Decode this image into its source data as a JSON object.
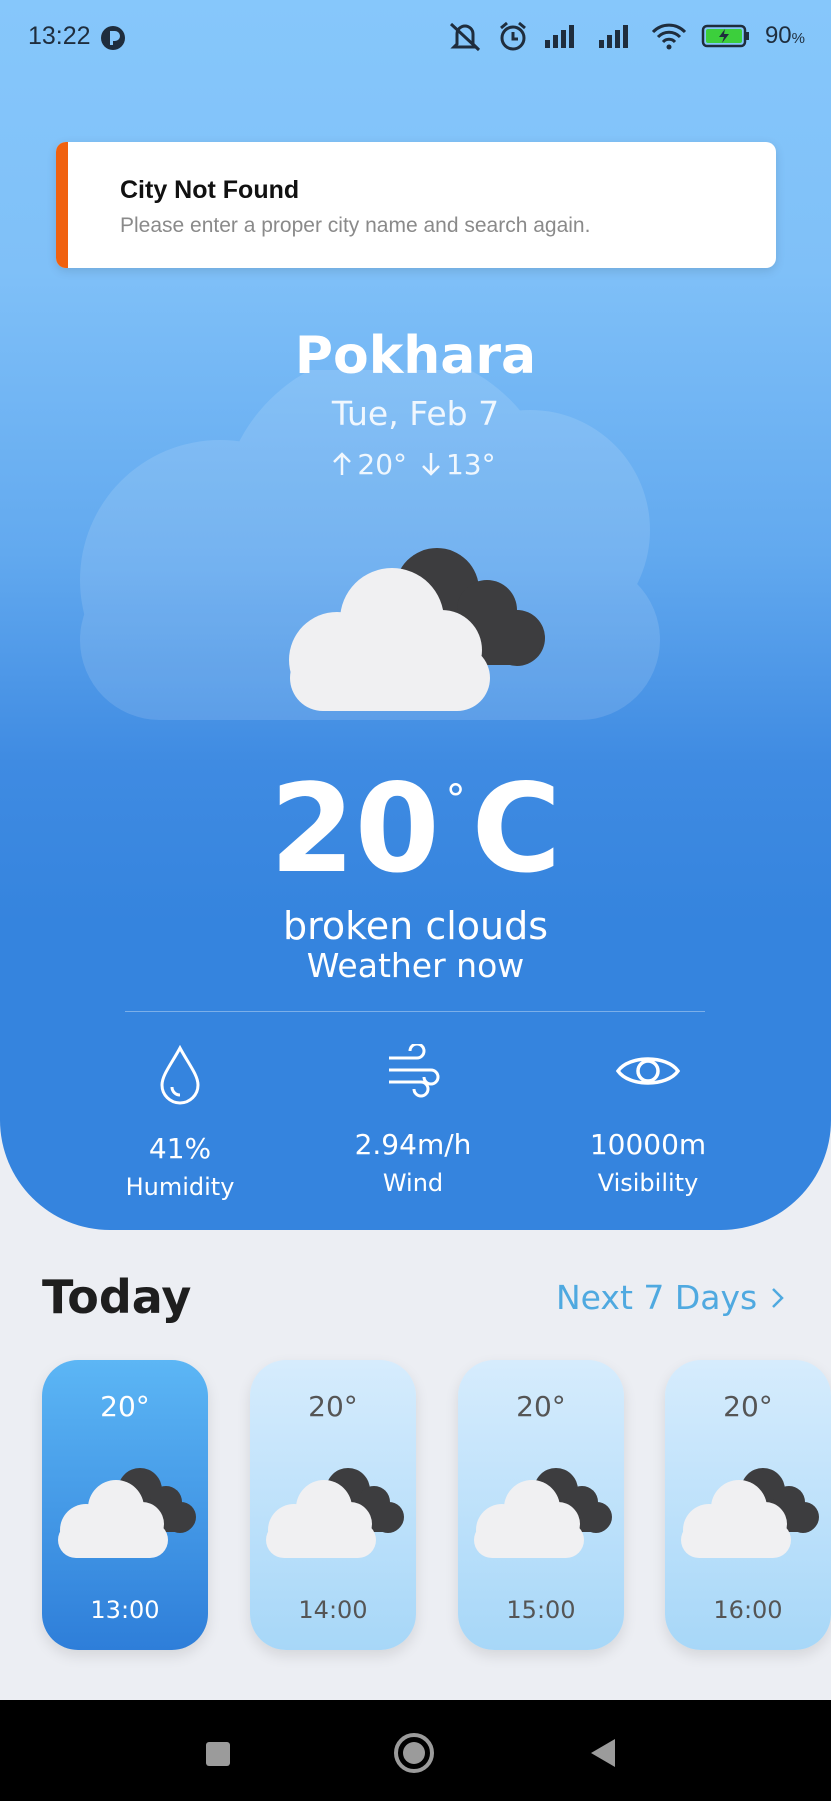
{
  "status_bar": {
    "time": "13:22",
    "battery_percent": "90",
    "battery_unit": "%"
  },
  "toast": {
    "title": "City Not Found",
    "message": "Please enter a proper city name and search again.",
    "accent_color": "#f0610f"
  },
  "current": {
    "city": "Pokhara",
    "date": "Tue, Feb 7",
    "high": "20°",
    "low": "13°",
    "temperature": "20",
    "degree_symbol": "°",
    "unit": "C",
    "description": "broken clouds",
    "subtitle": "Weather now",
    "icon": "broken-clouds-icon"
  },
  "stats": [
    {
      "value": "41%",
      "label": "Humidity",
      "icon": "droplet-icon"
    },
    {
      "value": "2.94m/h",
      "label": "Wind",
      "icon": "wind-icon"
    },
    {
      "value": "10000m",
      "label": "Visibility",
      "icon": "eye-icon"
    }
  ],
  "forecast": {
    "heading": "Today",
    "next_link": "Next 7 Days",
    "hours": [
      {
        "temp": "20°",
        "time": "13:00",
        "active": true
      },
      {
        "temp": "20°",
        "time": "14:00",
        "active": false
      },
      {
        "temp": "20°",
        "time": "15:00",
        "active": false
      },
      {
        "temp": "20°",
        "time": "16:00",
        "active": false
      }
    ]
  },
  "colors": {
    "hero_top": "#86c7fb",
    "hero_bottom": "#3584de",
    "link": "#4fa9e0",
    "background": "#eceef3"
  }
}
